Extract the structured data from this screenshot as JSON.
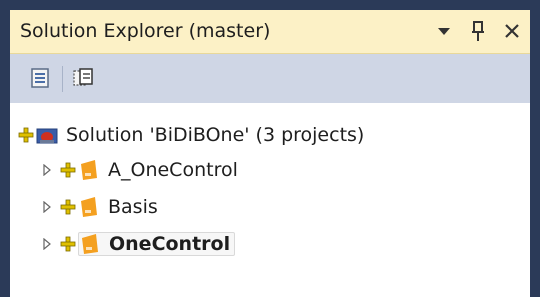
{
  "window": {
    "title": "Solution Explorer (master)",
    "icons": [
      "dropdown-arrow-icon",
      "pin-icon",
      "close-icon"
    ]
  },
  "toolbar": {
    "buttons": [
      "properties-icon",
      "show-all-files-icon"
    ]
  },
  "tree": {
    "solution_label": "Solution 'BiDiBOne' (3 projects)",
    "projects": [
      {
        "label": "A_OneControl",
        "selected": false
      },
      {
        "label": "Basis",
        "selected": false
      },
      {
        "label": "OneControl",
        "selected": true
      }
    ]
  },
  "colors": {
    "titlebar_bg": "#fcf1c6",
    "toolbar_bg": "#cfd6e5",
    "frame": "#2b3a58",
    "git_plus": "#e0c000",
    "project_icon": "#f4a020"
  }
}
